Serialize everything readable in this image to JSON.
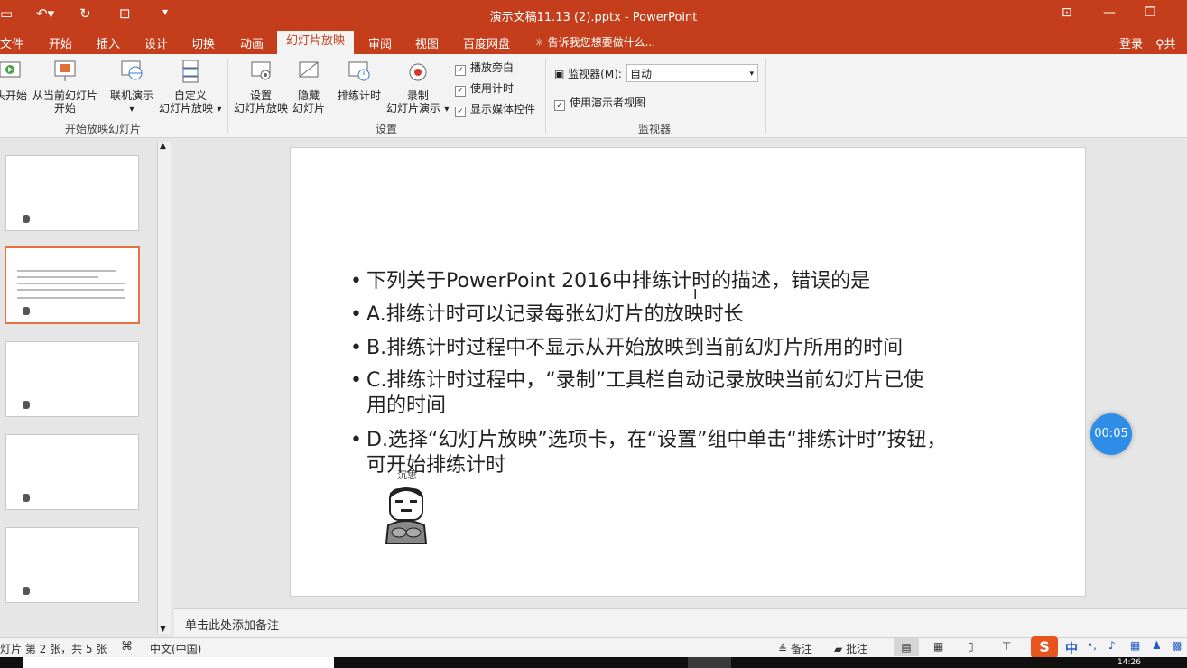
{
  "window": {
    "title": "演示文稿11.13 (2).pptx - PowerPoint"
  },
  "tabs": [
    {
      "label": "文件"
    },
    {
      "label": "开始"
    },
    {
      "label": "插入"
    },
    {
      "label": "设计"
    },
    {
      "label": "切换"
    },
    {
      "label": "动画"
    },
    {
      "label": "幻灯片放映",
      "active": true
    },
    {
      "label": "审阅"
    },
    {
      "label": "视图"
    },
    {
      "label": "百度网盘"
    }
  ],
  "tellme": "告诉我您想要做什么...",
  "account": {
    "login": "登录",
    "share": "共"
  },
  "ribbon": {
    "start_group": {
      "label": "开始放映幻灯片",
      "from_begin": "头开始",
      "from_current_1": "从当前幻灯片",
      "from_current_2": "开始",
      "online": "联机演示",
      "custom_1": "自定义",
      "custom_2": "幻灯片放映"
    },
    "setup_group": {
      "label": "设置",
      "setup_1": "设置",
      "setup_2": "幻灯片放映",
      "hide_1": "隐藏",
      "hide_2": "幻灯片",
      "rehearse": "排练计时",
      "record_1": "录制",
      "record_2": "幻灯片演示",
      "chk_narration": "播放旁白",
      "chk_timing": "使用计时",
      "chk_media": "显示媒体控件"
    },
    "monitor_group": {
      "label": "监视器",
      "monitor_label": "监视器(M):",
      "monitor_value": "自动",
      "presenter_view": "使用演示者视图"
    }
  },
  "slide": {
    "bullets": [
      "下列关于PowerPoint 2016中排练计时的描述，错误的是",
      "A.排练计时可以记录每张幻灯片的放映时长",
      "B.排练计时过程中不显示从开始放映到当前幻灯片所用的时间",
      "C.排练计时过程中，“录制”工具栏自动记录放映当前幻灯片已使",
      "用的时间",
      "D.选择“幻灯片放映”选项卡，在“设置”组中单击“排练计时”按钮，",
      "可开始排练计时"
    ],
    "avatar_caption": "沉思"
  },
  "notes_placeholder": "单击此处添加备注",
  "status": {
    "slide_info": "灯片 第 2 张，共 5 张",
    "language": "中文(中国)",
    "notes_btn": "备注",
    "comments_btn": "批注"
  },
  "timer": "00:05",
  "ime": {
    "lang": "中"
  },
  "clock": "14:26",
  "colors": {
    "accent": "#c43e1c",
    "selected_thumb": "#e8703f",
    "timer": "#2e8de6"
  }
}
